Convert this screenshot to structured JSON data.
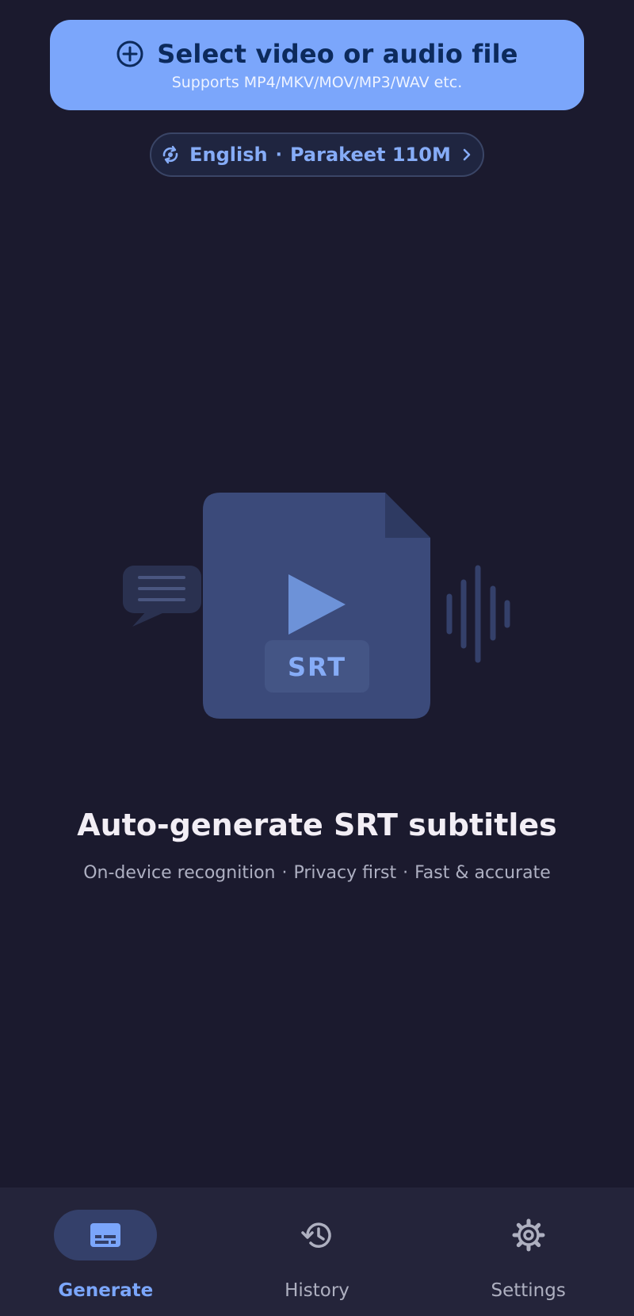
{
  "select_file": {
    "title": "Select video or audio file",
    "subtitle": "Supports MP4/MKV/MOV/MP3/WAV etc.",
    "icon": "add-circle-icon"
  },
  "model_chip": {
    "language": "English",
    "separator": "·",
    "model": "Parakeet 110M",
    "icon": "language-sync-icon",
    "chevron": "chevron-right-icon"
  },
  "illustration": {
    "badge": "SRT"
  },
  "hero": {
    "title": "Auto-generate SRT subtitles",
    "features": [
      "On-device recognition",
      "Privacy first",
      "Fast & accurate"
    ],
    "separator": "·"
  },
  "bottom_nav": {
    "items": [
      {
        "label": "Generate",
        "icon": "subtitles-icon",
        "active": true
      },
      {
        "label": "History",
        "icon": "history-icon",
        "active": false
      },
      {
        "label": "Settings",
        "icon": "gear-icon",
        "active": false
      }
    ]
  },
  "colors": {
    "background": "#1b1a2e",
    "accent": "#7ba6fb",
    "nav_background": "#24243a"
  }
}
